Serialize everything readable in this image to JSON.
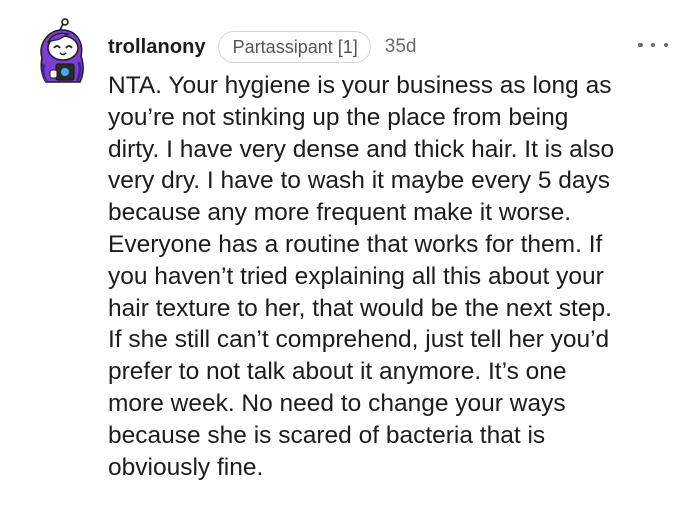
{
  "comment": {
    "author": "trollanony",
    "flair": "Partassipant [1]",
    "age": "35d",
    "body_lines": [
      "NTA. Your hygiene is your business as long as",
      "you’re not stinking up the place from being",
      "dirty. I have very dense and thick hair. It is also",
      "very dry. I have to wash it maybe every 5 days",
      "because any more frequent make it worse.",
      "Everyone has a routine that works for them. If",
      "you haven’t tried explaining all this about your",
      "hair texture to her, that would be the next step.",
      "If she still can’t comprehend, just tell her you’d",
      "prefer to not talk about it anymore. It’s one",
      "more week. No need to change your ways",
      "because she is scared of bacteria that is",
      "obviously fine."
    ],
    "avatar_icon": "snoo-avatar-icon",
    "more_icon": "more-options-icon"
  },
  "colors": {
    "text": "#1c1c1c",
    "muted": "#6a6a6a",
    "flair_border": "#d6d6d6",
    "avatar_purple": "#7b3fd1"
  }
}
